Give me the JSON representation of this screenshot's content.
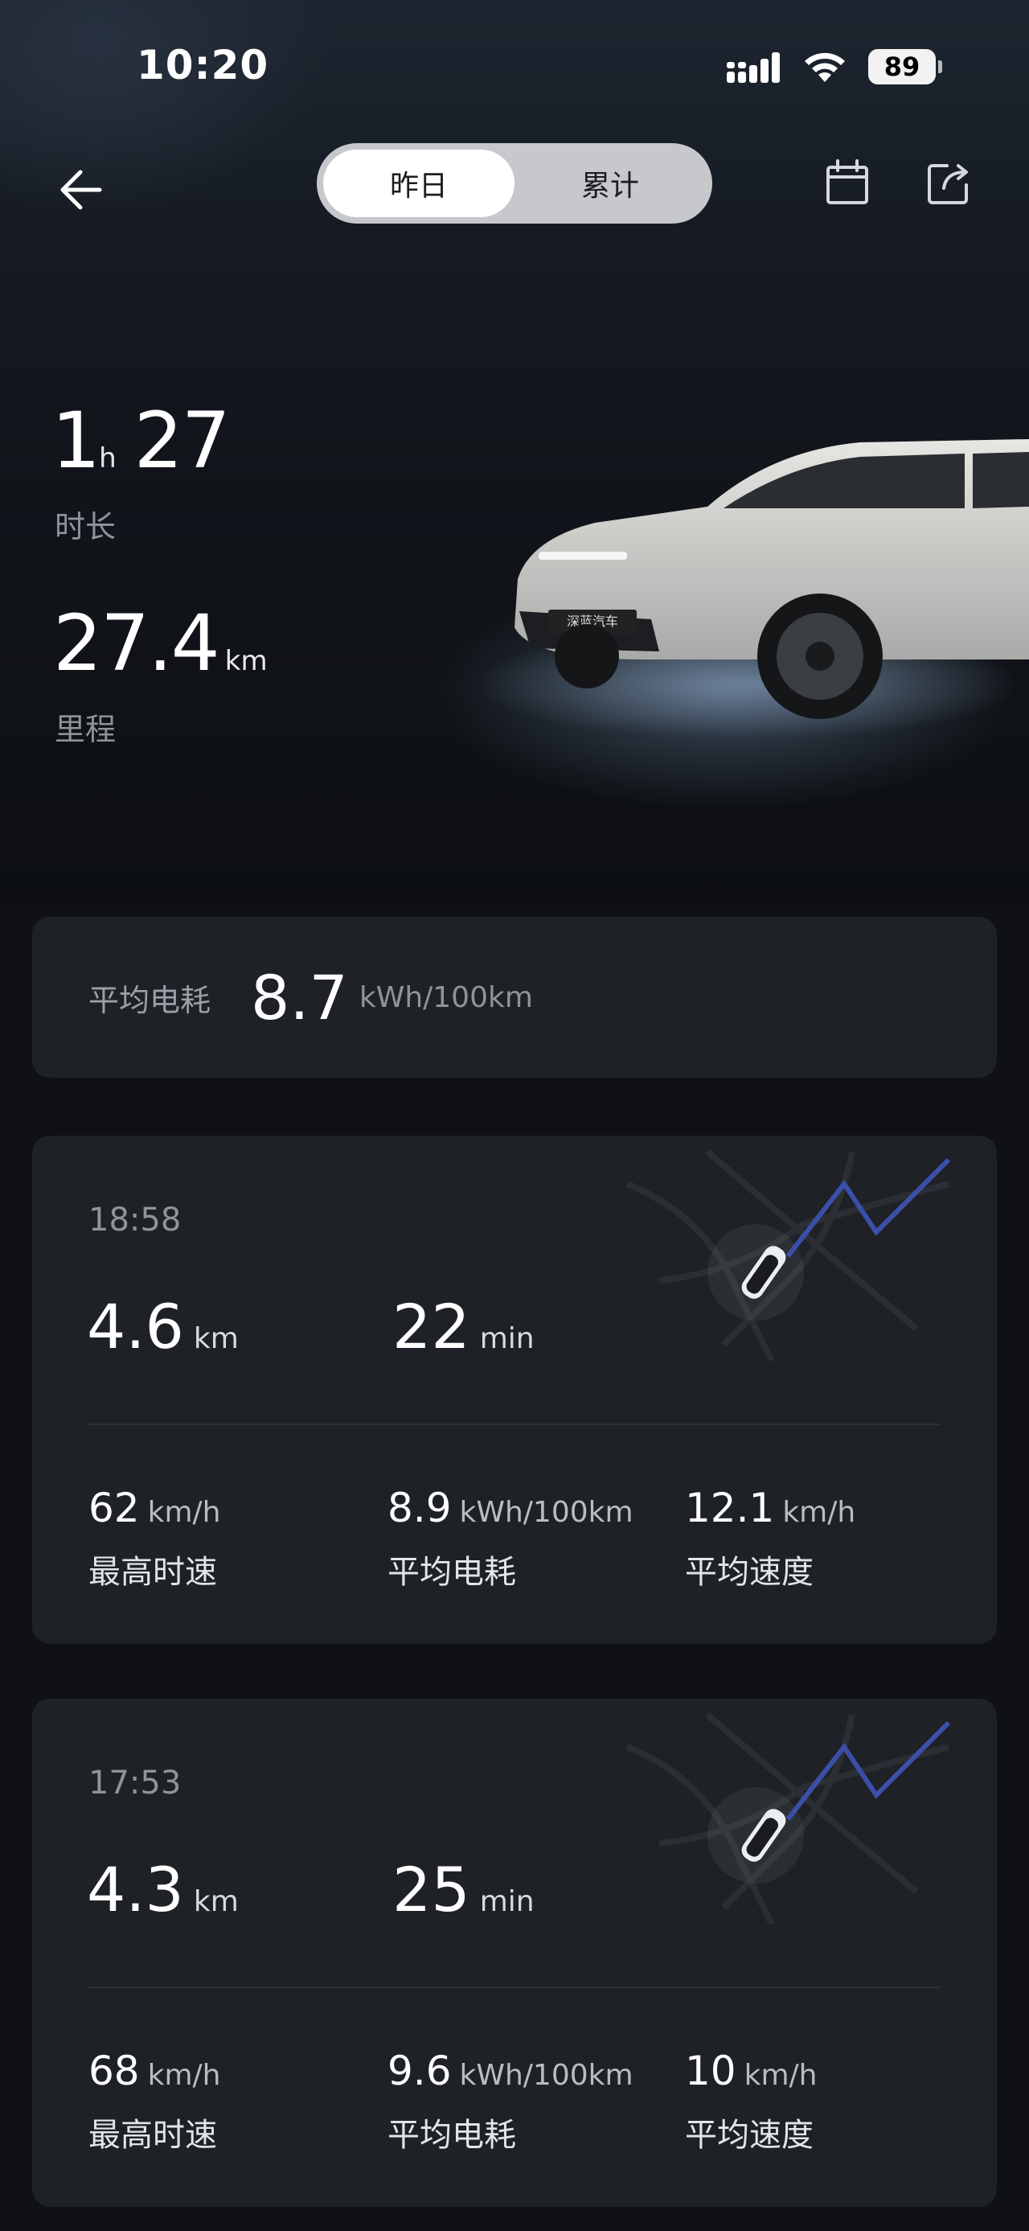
{
  "status": {
    "time": "10:20",
    "battery": "89"
  },
  "nav": {
    "tabs": [
      {
        "label": "昨日",
        "active": true
      },
      {
        "label": "累计",
        "active": false
      }
    ]
  },
  "summary": {
    "duration_h": "1",
    "duration_h_unit": "h",
    "duration_m": "27",
    "duration_label": "时长",
    "distance": "27.4",
    "distance_unit": "km",
    "distance_label": "里程",
    "car_plate": "深蓝汽车"
  },
  "avg_consumption": {
    "label": "平均电耗",
    "value": "8.7",
    "unit": "kWh/100km"
  },
  "trips": [
    {
      "time": "18:58",
      "distance": "4.6",
      "distance_unit": "km",
      "duration": "22",
      "duration_unit": "min",
      "max_speed": "62",
      "max_speed_unit": "km/h",
      "max_speed_label": "最高时速",
      "consumption": "8.9",
      "consumption_unit": "kWh/100km",
      "consumption_label": "平均电耗",
      "avg_speed": "12.1",
      "avg_speed_unit": "km/h",
      "avg_speed_label": "平均速度"
    },
    {
      "time": "17:53",
      "distance": "4.3",
      "distance_unit": "km",
      "duration": "25",
      "duration_unit": "min",
      "max_speed": "68",
      "max_speed_unit": "km/h",
      "max_speed_label": "最高时速",
      "consumption": "9.6",
      "consumption_unit": "kWh/100km",
      "consumption_label": "平均电耗",
      "avg_speed": "10",
      "avg_speed_unit": "km/h",
      "avg_speed_label": "平均速度"
    }
  ],
  "colors": {
    "background": "#0f1114",
    "card": "#1e2126",
    "route": "#3b4fa8",
    "muted": "#8f949b"
  },
  "icons": {
    "back": "back-arrow-icon",
    "calendar": "calendar-icon",
    "share": "share-icon"
  }
}
